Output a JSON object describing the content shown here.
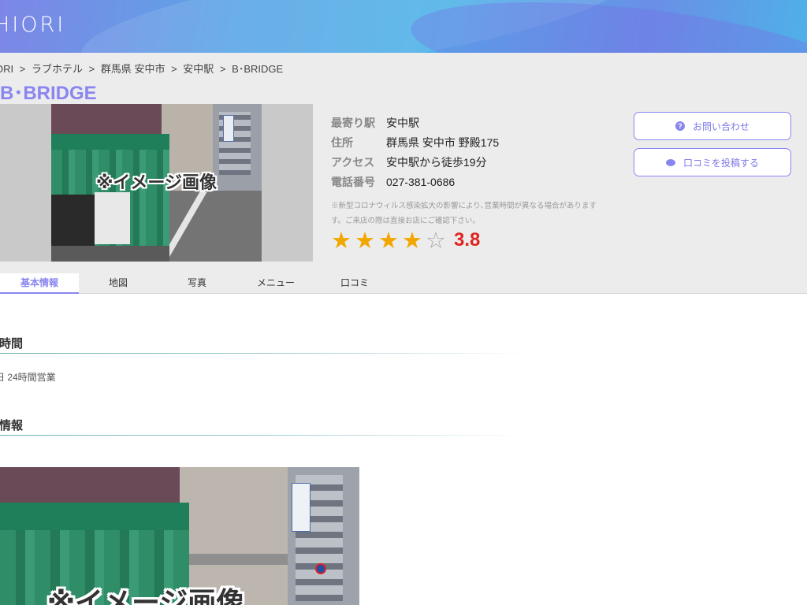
{
  "header": {
    "logo_text": "HIORI"
  },
  "breadcrumb": [
    "ORI",
    "ラブホテル",
    "群馬県 安中市",
    "安中駅",
    "B･BRIDGE"
  ],
  "breadcrumb_separator": ">",
  "hotel": {
    "name": "B･BRIDGE",
    "image_overlay": "※イメージ画像"
  },
  "details": [
    {
      "label": "最寄り駅",
      "value": "安中駅"
    },
    {
      "label": "住所",
      "value": "群馬県 安中市 野殿175"
    },
    {
      "label": "アクセス",
      "value": "安中駅から徒歩19分"
    },
    {
      "label": "電話番号",
      "value": "027-381-0686"
    }
  ],
  "notice": "※新型コロナウィルス感染拡大の影響により､営業時間が異なる場合がありますす。ご来店の際は直接お店にご確認下さい。",
  "rating": {
    "value": "3.8",
    "stars_full": 4,
    "stars_total": 5,
    "star_color": "#f2a700",
    "value_color": "#e0241e"
  },
  "actions": {
    "inquiry_label": "お問い合わせ",
    "review_label": "口コミを投稿する"
  },
  "tabs": [
    {
      "label": "基本情報",
      "active": true
    },
    {
      "label": "地図",
      "active": false
    },
    {
      "label": "写真",
      "active": false
    },
    {
      "label": "メニュー",
      "active": false
    },
    {
      "label": "口コミ",
      "active": false
    }
  ],
  "sections": {
    "hours_title": "業時間",
    "hours_text": "日 24時間営業",
    "info_title": "本情報"
  },
  "colors": {
    "accent": "#8a86f0",
    "info_bg": "#ececec"
  }
}
